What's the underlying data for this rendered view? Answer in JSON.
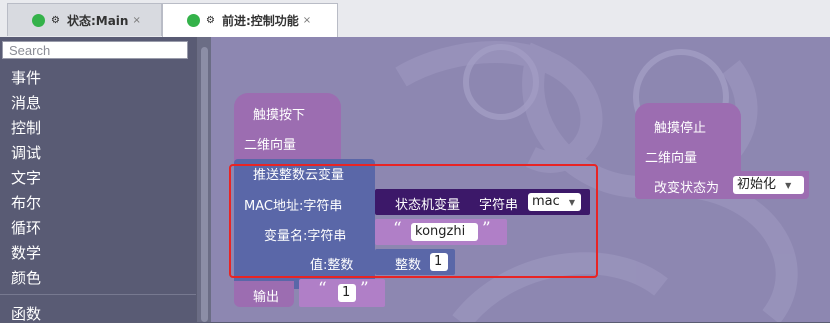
{
  "tabs": [
    {
      "icon": "gear-icon",
      "label": "状态:Main",
      "close": "×"
    },
    {
      "icon": "gear-icon",
      "label": "前进:控制功能",
      "close": "×"
    }
  ],
  "sidebar": {
    "search_placeholder": "Search",
    "categories": [
      "事件",
      "消息",
      "控制",
      "调试",
      "文字",
      "布尔",
      "循环",
      "数学",
      "颜色",
      "函数"
    ]
  },
  "blocks": {
    "touch_down": {
      "title": "触摸按下",
      "param": "二维向量"
    },
    "push_int": {
      "title": "推送整数云变量",
      "mac_label": "MAC地址:字符串",
      "var_label": "变量名:字符串",
      "val_label": "值:整数",
      "state_var": {
        "label": "状态机变量",
        "type": "字符串",
        "value": "mac"
      },
      "string_value": "kongzhi",
      "int_label": "整数",
      "int_value": "1"
    },
    "output": {
      "label": "输出",
      "value": "1"
    },
    "touch_stop": {
      "title": "触摸停止",
      "param": "二维向量",
      "change_state": "改变状态为",
      "state_value": "初始化"
    }
  },
  "colors": {
    "event_block": "#9c6db1",
    "func_block": "#5a67a8",
    "var_block": "#3c1869",
    "text_block": "#b07fc7"
  }
}
